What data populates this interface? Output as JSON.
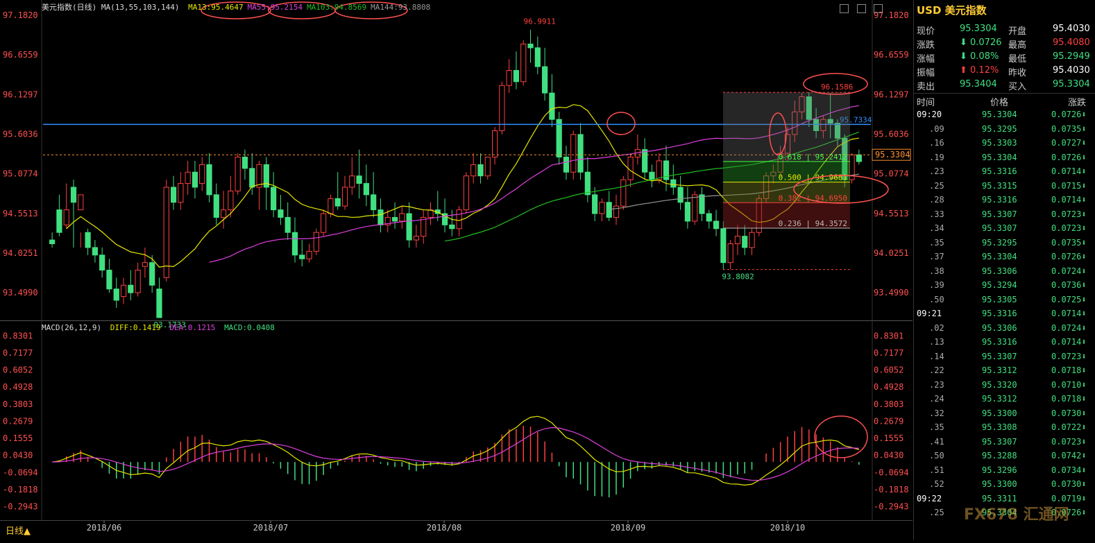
{
  "chart_data": {
    "type": "candlestick",
    "title": "美元指数(日线)",
    "ma_label": "MA(13,55,103,144)",
    "ma_values": [
      {
        "name": "MA13",
        "value": "95.4647",
        "color": "#e8e800"
      },
      {
        "name": "MA55",
        "value": "95.2154",
        "color": "#e040e0"
      },
      {
        "name": "MA103",
        "value": "94.8569",
        "color": "#20c020"
      },
      {
        "name": "MA144",
        "value": "93.8808",
        "color": "#999999"
      }
    ],
    "ylim": [
      93.17,
      97.2
    ],
    "y_ticks": [
      "97.1820",
      "96.6559",
      "96.1297",
      "95.6036",
      "95.0774",
      "94.5513",
      "94.0251",
      "93.4990"
    ],
    "x_ticks": [
      "2018/06",
      "2018/07",
      "2018/08",
      "2018/09",
      "2018/10"
    ],
    "candles": [
      [
        94.2,
        94.3,
        94.15,
        94.1
      ],
      [
        94.6,
        94.8,
        94.3,
        94.25
      ],
      [
        94.4,
        94.95,
        94.6,
        94.35
      ],
      [
        94.9,
        95.0,
        94.7,
        94.1
      ],
      [
        94.6,
        94.3,
        94.8,
        94.1
      ],
      [
        94.3,
        94.35,
        94.1,
        94.0
      ],
      [
        94.1,
        94.2,
        94.0,
        93.9
      ],
      [
        94.0,
        94.1,
        93.8,
        93.7
      ],
      [
        93.8,
        93.95,
        93.55,
        93.5
      ],
      [
        93.55,
        93.7,
        93.4,
        93.3
      ],
      [
        93.45,
        93.7,
        93.6,
        93.35
      ],
      [
        93.6,
        93.8,
        93.5,
        93.4
      ],
      [
        93.5,
        93.9,
        93.8,
        93.45
      ],
      [
        93.85,
        94.1,
        93.9,
        93.7
      ],
      [
        93.9,
        94.0,
        93.6,
        93.5
      ],
      [
        93.55,
        93.7,
        93.17,
        93.17
      ],
      [
        93.7,
        95.0,
        94.9,
        93.65
      ],
      [
        94.9,
        95.05,
        94.7,
        94.6
      ],
      [
        94.7,
        95.1,
        94.95,
        94.6
      ],
      [
        94.95,
        95.25,
        95.1,
        94.8
      ],
      [
        95.1,
        95.25,
        94.9,
        94.75
      ],
      [
        94.95,
        95.3,
        95.2,
        94.85
      ],
      [
        95.2,
        95.35,
        94.8,
        94.7
      ],
      [
        94.8,
        94.95,
        94.5,
        94.4
      ],
      [
        94.5,
        94.85,
        94.6,
        94.35
      ],
      [
        94.6,
        95.05,
        94.85,
        94.5
      ],
      [
        94.85,
        95.35,
        95.3,
        94.8
      ],
      [
        95.3,
        95.4,
        95.15,
        95.0
      ],
      [
        95.15,
        95.35,
        94.9,
        94.8
      ],
      [
        94.9,
        95.25,
        95.2,
        94.6
      ],
      [
        95.2,
        95.3,
        94.9,
        94.6
      ],
      [
        94.9,
        95.1,
        94.6,
        94.5
      ],
      [
        94.6,
        94.8,
        94.5,
        94.4
      ],
      [
        94.5,
        94.7,
        94.3,
        94.2
      ],
      [
        94.3,
        94.5,
        94.0,
        93.9
      ],
      [
        94.0,
        94.2,
        93.95,
        93.85
      ],
      [
        93.95,
        94.15,
        94.05,
        93.9
      ],
      [
        94.05,
        94.35,
        94.3,
        94.0
      ],
      [
        94.3,
        94.6,
        94.55,
        94.25
      ],
      [
        94.55,
        94.8,
        94.75,
        94.5
      ],
      [
        94.75,
        95.1,
        94.65,
        94.6
      ],
      [
        94.65,
        95.05,
        94.9,
        94.6
      ],
      [
        94.9,
        95.3,
        95.05,
        94.8
      ],
      [
        95.05,
        95.4,
        94.95,
        94.75
      ],
      [
        94.95,
        95.2,
        94.8,
        94.65
      ],
      [
        94.8,
        95.1,
        94.6,
        94.5
      ],
      [
        94.6,
        94.75,
        94.4,
        94.3
      ],
      [
        94.4,
        94.6,
        94.5,
        94.3
      ],
      [
        94.5,
        94.7,
        94.45,
        94.35
      ],
      [
        94.45,
        94.65,
        94.55,
        94.35
      ],
      [
        94.55,
        94.7,
        94.2,
        94.1
      ],
      [
        94.2,
        94.4,
        94.25,
        94.1
      ],
      [
        94.25,
        94.6,
        94.5,
        94.15
      ],
      [
        94.5,
        94.7,
        94.6,
        94.4
      ],
      [
        94.6,
        94.85,
        94.55,
        94.45
      ],
      [
        94.55,
        94.75,
        94.4,
        94.3
      ],
      [
        94.4,
        94.6,
        94.35,
        94.25
      ],
      [
        94.35,
        94.65,
        94.6,
        94.25
      ],
      [
        94.6,
        95.1,
        95.05,
        94.55
      ],
      [
        95.05,
        95.35,
        95.2,
        94.95
      ],
      [
        95.2,
        95.35,
        95.05,
        94.95
      ],
      [
        95.05,
        95.2,
        95.3,
        95.0
      ],
      [
        95.3,
        95.7,
        95.65,
        95.2
      ],
      [
        95.65,
        96.3,
        96.25,
        95.6
      ],
      [
        96.25,
        96.6,
        96.45,
        96.15
      ],
      [
        96.45,
        96.7,
        96.3,
        96.2
      ],
      [
        96.3,
        96.85,
        96.8,
        96.25
      ],
      [
        96.8,
        96.99,
        96.75,
        96.55
      ],
      [
        96.75,
        96.9,
        96.5,
        96.4
      ],
      [
        96.5,
        96.75,
        96.15,
        96.05
      ],
      [
        96.15,
        96.4,
        95.8,
        95.7
      ],
      [
        95.8,
        95.9,
        95.3,
        95.2
      ],
      [
        95.3,
        95.45,
        95.1,
        95.0
      ],
      [
        95.1,
        95.65,
        95.6,
        95.0
      ],
      [
        95.6,
        95.75,
        95.1,
        95.0
      ],
      [
        95.1,
        95.3,
        94.8,
        94.7
      ],
      [
        94.8,
        94.9,
        94.55,
        94.45
      ],
      [
        94.55,
        94.75,
        94.7,
        94.45
      ],
      [
        94.7,
        94.85,
        94.5,
        94.45
      ],
      [
        94.5,
        94.8,
        94.65,
        94.4
      ],
      [
        94.65,
        95.05,
        95.0,
        94.6
      ],
      [
        95.0,
        95.35,
        95.3,
        94.9
      ],
      [
        95.3,
        95.6,
        95.4,
        95.2
      ],
      [
        95.4,
        95.55,
        95.1,
        95.0
      ],
      [
        95.1,
        95.2,
        95.0,
        94.9
      ],
      [
        95.0,
        95.35,
        95.25,
        94.95
      ],
      [
        95.25,
        95.45,
        95.0,
        94.85
      ],
      [
        95.0,
        95.2,
        94.9,
        94.8
      ],
      [
        94.9,
        95.05,
        94.7,
        94.6
      ],
      [
        94.7,
        94.9,
        94.45,
        94.35
      ],
      [
        94.45,
        94.85,
        94.8,
        94.4
      ],
      [
        94.8,
        94.9,
        94.55,
        94.45
      ],
      [
        94.55,
        94.6,
        94.45,
        94.35
      ],
      [
        94.45,
        94.6,
        94.35,
        94.25
      ],
      [
        94.35,
        94.45,
        93.9,
        93.81
      ],
      [
        93.9,
        94.2,
        94.15,
        93.81
      ],
      [
        94.15,
        94.4,
        94.25,
        94.0
      ],
      [
        94.25,
        94.4,
        94.1,
        94.0
      ],
      [
        94.1,
        94.35,
        94.3,
        94.0
      ],
      [
        94.3,
        94.8,
        94.75,
        94.25
      ],
      [
        94.75,
        95.1,
        95.05,
        94.7
      ],
      [
        95.05,
        95.2,
        95.1,
        94.95
      ],
      [
        95.1,
        95.45,
        95.35,
        95.05
      ],
      [
        95.35,
        95.7,
        95.6,
        95.25
      ],
      [
        95.6,
        96.05,
        95.9,
        95.5
      ],
      [
        95.9,
        96.15,
        96.1,
        95.8
      ],
      [
        96.1,
        96.16,
        95.8,
        95.7
      ],
      [
        95.8,
        95.95,
        95.65,
        95.55
      ],
      [
        95.65,
        95.85,
        95.8,
        95.55
      ],
      [
        95.8,
        96.15,
        95.75,
        95.55
      ],
      [
        95.75,
        95.8,
        95.55,
        95.45
      ],
      [
        95.55,
        95.6,
        95.0,
        94.9
      ],
      [
        95.0,
        95.35,
        95.33,
        94.95
      ],
      [
        95.33,
        95.4,
        95.24,
        95.2
      ]
    ],
    "annotations": [
      "96.9911",
      "93.1733",
      "93.8082",
      "96.1586",
      "95.7334"
    ],
    "fib_levels": [
      {
        "label": "0.618 | 95.2412",
        "value": 95.2412,
        "color": "#40ff40"
      },
      {
        "label": "0.500 | 94.9681",
        "value": 94.9681,
        "color": "#e8e800"
      },
      {
        "label": "0.382 | 94.6950",
        "value": 94.695,
        "color": "#ff4040"
      },
      {
        "label": "0.236 | 94.3572",
        "value": 94.3572,
        "color": "#bbbbbb"
      }
    ],
    "current_price": "95.3304",
    "resistance": 95.7334,
    "macd": {
      "label": "MACD(26,12,9)",
      "diff": "DIFF:0.1419",
      "dea": "DEA:0.1215",
      "macd": "MACD:0.0408",
      "ylim": [
        -0.36,
        0.85
      ],
      "y_ticks": [
        "0.8301",
        "0.7177",
        "0.6052",
        "0.4928",
        "0.3803",
        "0.2679",
        "0.1555",
        "0.0430",
        "-0.0694",
        "-0.1818",
        "-0.2943"
      ]
    }
  },
  "bottom": {
    "period": "日线▲"
  },
  "side": {
    "title": "USD 美元指数",
    "quote": [
      {
        "l1": "现价",
        "v1": "95.3304",
        "c1": "#40e080",
        "l2": "开盘",
        "v2": "95.4030",
        "c2": "#ffffff"
      },
      {
        "l1": "涨跌",
        "v1": "⬇ 0.0726",
        "c1": "#40e080",
        "l2": "最高",
        "v2": "95.4080",
        "c2": "#ff4040"
      },
      {
        "l1": "涨幅",
        "v1": "⬇ 0.08%",
        "c1": "#40e080",
        "l2": "最低",
        "v2": "95.2949",
        "c2": "#40e080"
      },
      {
        "l1": "振幅",
        "v1": "⬆ 0.12%",
        "c1": "#ff4040",
        "l2": "昨收",
        "v2": "95.4030",
        "c2": "#ffffff"
      },
      {
        "l1": "卖出",
        "v1": "95.3404",
        "c1": "#40e080",
        "l2": "买入",
        "v2": "95.3304",
        "c2": "#40e080"
      }
    ],
    "tick_header": {
      "t": "时间",
      "p": "价格",
      "c": "涨跌"
    },
    "ticks": [
      {
        "t": "09:20",
        "p": "95.3304",
        "c": "0.0726⬇"
      },
      {
        "t": ".09",
        "p": "95.3295",
        "c": "0.0735⬇"
      },
      {
        "t": ".16",
        "p": "95.3303",
        "c": "0.0727⬇"
      },
      {
        "t": ".19",
        "p": "95.3304",
        "c": "0.0726⬇"
      },
      {
        "t": ".23",
        "p": "95.3316",
        "c": "0.0714⬇"
      },
      {
        "t": ".25",
        "p": "95.3315",
        "c": "0.0715⬇"
      },
      {
        "t": ".28",
        "p": "95.3316",
        "c": "0.0714⬇"
      },
      {
        "t": ".33",
        "p": "95.3307",
        "c": "0.0723⬇"
      },
      {
        "t": ".34",
        "p": "95.3307",
        "c": "0.0723⬇"
      },
      {
        "t": ".35",
        "p": "95.3295",
        "c": "0.0735⬇"
      },
      {
        "t": ".37",
        "p": "95.3304",
        "c": "0.0726⬇"
      },
      {
        "t": ".38",
        "p": "95.3306",
        "c": "0.0724⬇"
      },
      {
        "t": ".39",
        "p": "95.3294",
        "c": "0.0736⬇"
      },
      {
        "t": ".50",
        "p": "95.3305",
        "c": "0.0725⬇"
      },
      {
        "t": "09:21",
        "p": "95.3316",
        "c": "0.0714⬇"
      },
      {
        "t": ".02",
        "p": "95.3306",
        "c": "0.0724⬇"
      },
      {
        "t": ".13",
        "p": "95.3316",
        "c": "0.0714⬇"
      },
      {
        "t": ".14",
        "p": "95.3307",
        "c": "0.0723⬇"
      },
      {
        "t": ".22",
        "p": "95.3312",
        "c": "0.0718⬇"
      },
      {
        "t": ".23",
        "p": "95.3320",
        "c": "0.0710⬇"
      },
      {
        "t": ".24",
        "p": "95.3312",
        "c": "0.0718⬇"
      },
      {
        "t": ".32",
        "p": "95.3300",
        "c": "0.0730⬇"
      },
      {
        "t": ".35",
        "p": "95.3308",
        "c": "0.0722⬇"
      },
      {
        "t": ".41",
        "p": "95.3307",
        "c": "0.0723⬇"
      },
      {
        "t": ".50",
        "p": "95.3288",
        "c": "0.0742⬇"
      },
      {
        "t": ".51",
        "p": "95.3296",
        "c": "0.0734⬇"
      },
      {
        "t": ".52",
        "p": "95.3300",
        "c": "0.0730⬇"
      },
      {
        "t": "09:22",
        "p": "95.3311",
        "c": "0.0719⬇"
      },
      {
        "t": ".25",
        "p": "95.3304",
        "c": "0.0726⬇"
      }
    ],
    "watermark": "FX678 汇通网"
  }
}
